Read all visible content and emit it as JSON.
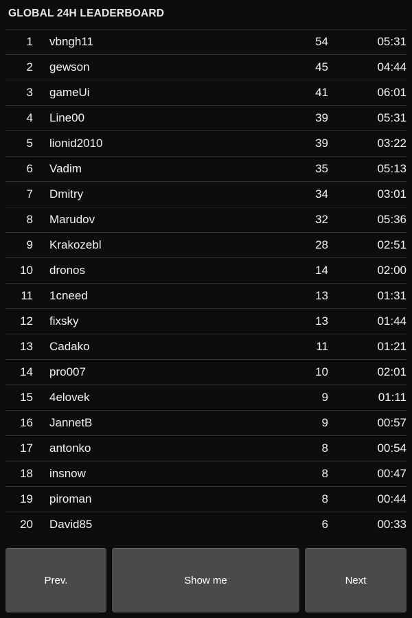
{
  "header": {
    "title": "GLOBAL 24H LEADERBOARD"
  },
  "theme": {
    "background": "#0d0d0d",
    "text": "#f2f2f2",
    "separator": "#333333",
    "button_background": "#4a4a4a",
    "button_border": "#6a6a6a"
  },
  "leaderboard": {
    "rows": [
      {
        "rank": "1",
        "name": "vbngh11",
        "score": "54",
        "time": "05:31"
      },
      {
        "rank": "2",
        "name": "gewson",
        "score": "45",
        "time": "04:44"
      },
      {
        "rank": "3",
        "name": "gameUi",
        "score": "41",
        "time": "06:01"
      },
      {
        "rank": "4",
        "name": "Line00",
        "score": "39",
        "time": "05:31"
      },
      {
        "rank": "5",
        "name": "lionid2010",
        "score": "39",
        "time": "03:22"
      },
      {
        "rank": "6",
        "name": "Vadim",
        "score": "35",
        "time": "05:13"
      },
      {
        "rank": "7",
        "name": "Dmitry",
        "score": "34",
        "time": "03:01"
      },
      {
        "rank": "8",
        "name": "Marudov",
        "score": "32",
        "time": "05:36"
      },
      {
        "rank": "9",
        "name": "Krakozebl",
        "score": "28",
        "time": "02:51"
      },
      {
        "rank": "10",
        "name": "dronos",
        "score": "14",
        "time": "02:00"
      },
      {
        "rank": "11",
        "name": "1cneed",
        "score": "13",
        "time": "01:31"
      },
      {
        "rank": "12",
        "name": "fixsky",
        "score": "13",
        "time": "01:44"
      },
      {
        "rank": "13",
        "name": "Cadako",
        "score": "11",
        "time": "01:21"
      },
      {
        "rank": "14",
        "name": "pro007",
        "score": "10",
        "time": "02:01"
      },
      {
        "rank": "15",
        "name": "4elovek",
        "score": "9",
        "time": "01:11"
      },
      {
        "rank": "16",
        "name": "JannetB",
        "score": "9",
        "time": "00:57"
      },
      {
        "rank": "17",
        "name": "antonko",
        "score": "8",
        "time": "00:54"
      },
      {
        "rank": "18",
        "name": "insnow",
        "score": "8",
        "time": "00:47"
      },
      {
        "rank": "19",
        "name": "piroman",
        "score": "8",
        "time": "00:44"
      },
      {
        "rank": "20",
        "name": "David85",
        "score": "6",
        "time": "00:33"
      }
    ]
  },
  "buttons": {
    "prev": "Prev.",
    "show": "Show me",
    "next": "Next"
  }
}
